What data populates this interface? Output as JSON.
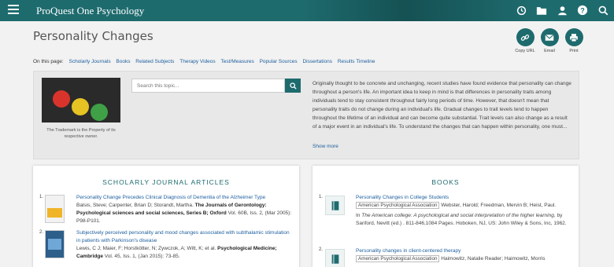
{
  "header": {
    "brand": "ProQuest One Psychology",
    "icons": [
      "menu-icon",
      "history-icon",
      "folder-icon",
      "user-icon",
      "help-icon",
      "search-icon"
    ]
  },
  "page": {
    "title": "Personality Changes",
    "actions": [
      {
        "label": "Copy URL",
        "icon": "link-icon"
      },
      {
        "label": "Email",
        "icon": "email-icon"
      },
      {
        "label": "Print",
        "icon": "print-icon"
      }
    ],
    "on_this_page": {
      "label": "On this page:",
      "links": [
        "Scholarly Journals",
        "Books",
        "Related Subjects",
        "Therapy Videos",
        "Test/Measures",
        "Popular Sources",
        "Dissertations",
        "Results Timeline"
      ]
    }
  },
  "topic": {
    "image_caption": "The Trademark is the Property of its respective owner.",
    "search_placeholder": "Search this topic...",
    "summary": "Originally thought to be concrete and unchanging, recent studies have found evidence that personality can change throughout a person's life. An important idea to keep in mind is that differences in personality traits among individuals tend to stay consistent throughout fairly long periods of time. However, that doesn't mean that personality traits do not change during an individual's life. Gradual changes to trait levels tend to happen throughout the lifetime of an individual and can become quite substantial. Trait levels can also change as a result of a major event in an individual's life. To understand the changes that can happen within personality, one must...",
    "show_more": "Show more"
  },
  "journals": {
    "heading": "SCHOLARLY JOURNAL ARTICLES",
    "items": [
      {
        "num": "1.",
        "title": "Personality Change Precedes Clinical Diagnosis of Dementia of the Alzheimer Type",
        "authors": "Balsis, Steve; Carpenter, Brian D; Storandt, Martha.",
        "source": "The Journals of Gerontology: Psychological sciences and social sciences, Series B; Oxford",
        "details": "Vol. 60B, Iss. 2, (Mar 2005): P98-P101."
      },
      {
        "num": "2.",
        "title": "Subjectively perceived personality and mood changes associated with subthalamic stimulation in patients with Parkinson's disease",
        "authors": "Lewis, C J; Maier, F; Horstkötter, N; Zywczok, A; Witt, K; et al.",
        "source": "Psychological Medicine; Cambridge",
        "details": "Vol. 45, Iss. 1, (Jan 2015): 73-85."
      }
    ]
  },
  "books": {
    "heading": "BOOKS",
    "items": [
      {
        "num": "1.",
        "title": "Personality Changes in College Students",
        "publisher_tag": "American Psychological Association",
        "authors": "Webster, Harold; Freedman, Mervin B; Heist, Paul.",
        "in_prefix": "In",
        "in_title": "The American college: A psychological and social interpretation of the higher learning",
        "in_details": ", by Sanford, Nevitt (ed.) . 811-846,1084 Pages. Hoboken, NJ, US: John Wiley & Sons, Inc, 1962."
      },
      {
        "num": "2.",
        "title": "Personality changes in client-centered therapy",
        "publisher_tag": "American Psychological Association",
        "authors": "Haimowitz, Natalie Reader; Haimowitz, Morris"
      }
    ]
  },
  "colors": {
    "brand": "#1e6b6e",
    "link": "#1d5f9e"
  }
}
